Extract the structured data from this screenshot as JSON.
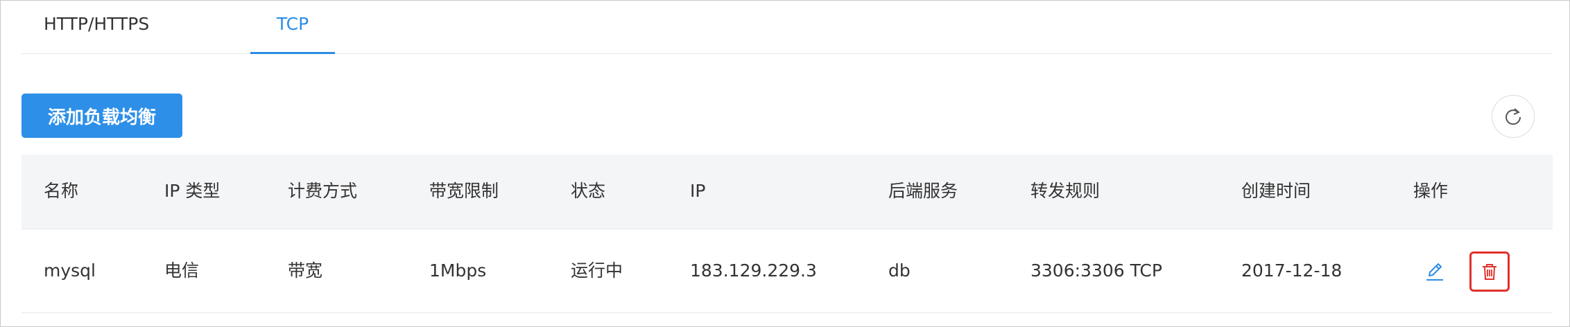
{
  "tabs": [
    {
      "label": "HTTP/HTTPS",
      "active": false
    },
    {
      "label": "TCP",
      "active": true
    }
  ],
  "toolbar": {
    "add_button_label": "添加负载均衡",
    "refresh_icon": "refresh-icon"
  },
  "table": {
    "columns": [
      "名称",
      "IP 类型",
      "计费方式",
      "带宽限制",
      "状态",
      "IP",
      "后端服务",
      "转发规则",
      "创建时间",
      "操作"
    ],
    "rows": [
      {
        "name": "mysql",
        "ip_type": "电信",
        "billing": "带宽",
        "bandwidth": "1Mbps",
        "status": "运行中",
        "ip": "183.129.229.3",
        "backend": "db",
        "rule": "3306:3306 TCP",
        "created": "2017-12-18",
        "actions": [
          "edit-icon",
          "delete-icon"
        ]
      }
    ]
  },
  "colors": {
    "accent": "#2c8ce6",
    "status_running": "#2ea65a",
    "delete_highlight": "#e0302b"
  }
}
